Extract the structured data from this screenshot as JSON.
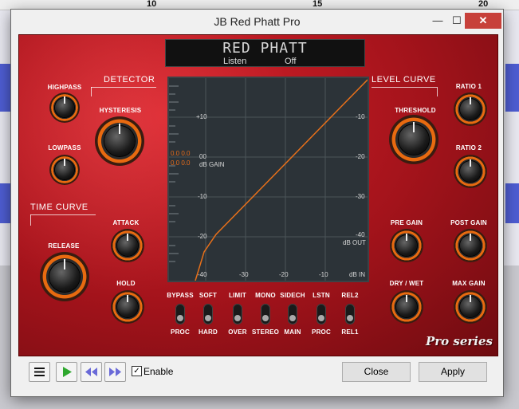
{
  "ruler": {
    "ticks": [
      "10",
      "15",
      "20"
    ]
  },
  "window": {
    "title": "JB Red Phatt Pro",
    "min_glyph": "—",
    "max_glyph": "☐",
    "close_glyph": "✕"
  },
  "display": {
    "title": "RED PHATT",
    "listen": "Listen",
    "listen_value": "Off"
  },
  "detector": {
    "section": "DETECTOR",
    "highpass": "HIGHPASS",
    "lowpass": "LOWPASS",
    "hysteresis": "HYSTERESIS"
  },
  "time_curve": {
    "section": "TIME CURVE",
    "attack": "ATTACK",
    "release": "RELEASE",
    "hold": "HOLD"
  },
  "level_curve": {
    "section": "LEVEL CURVE",
    "threshold": "THRESHOLD",
    "ratio1": "RATIO 1",
    "ratio2": "RATIO 2",
    "pre_gain": "PRE GAIN",
    "post_gain": "POST GAIN",
    "dry_wet": "DRY / WET",
    "max_gain": "MAX GAIN"
  },
  "graph": {
    "left_ticks": [
      "+10",
      "00",
      "-10",
      "-20",
      "-40"
    ],
    "right_ticks": [
      "-10",
      "-20",
      "-30",
      "-40"
    ],
    "bottom_ticks": [
      "-30",
      "-20",
      "-10"
    ],
    "db_gain": "dB GAIN",
    "db_out": "dB OUT",
    "db_in": "dB IN",
    "gain_readout_1": "0.0 0.0",
    "gain_readout_2": "0.0 0.0",
    "curve_color": "#e8701a"
  },
  "switches": [
    {
      "top": "BYPASS",
      "bottom": "PROC"
    },
    {
      "top": "SOFT",
      "bottom": "HARD"
    },
    {
      "top": "LIMIT",
      "bottom": "OVER"
    },
    {
      "top": "MONO",
      "bottom": "STEREO"
    },
    {
      "top": "SIDECH",
      "bottom": "MAIN"
    },
    {
      "top": "LSTN",
      "bottom": "PROC"
    },
    {
      "top": "REL2",
      "bottom": "REL1"
    }
  ],
  "branding": "Pro series",
  "toolbar": {
    "menu_icon": "hamburger-icon",
    "play_icon": "play-icon",
    "rewind_icon": "skip-back-icon",
    "forward_icon": "skip-forward-icon",
    "enable_label": "Enable",
    "enable_checked": "✓",
    "close_label": "Close",
    "apply_label": "Apply"
  },
  "colors": {
    "panel_red": "#c01a22",
    "accent_orange": "#e8701a",
    "close_red": "#c7403a"
  }
}
